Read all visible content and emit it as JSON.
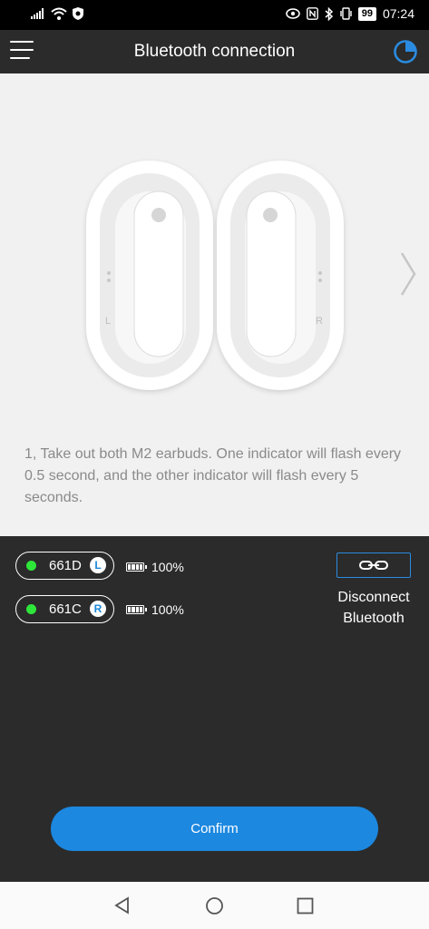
{
  "status": {
    "battery": "99",
    "time": "07:24"
  },
  "appbar": {
    "title": "Bluetooth connection"
  },
  "hero": {
    "left_label": "L",
    "right_label": "R",
    "instruction": "1, Take out both M2 earbuds. One indicator will flash every 0.5 second, and the other indicator will flash every 5 seconds."
  },
  "devices": [
    {
      "name": "661D",
      "side": "L",
      "battery": "100%",
      "connected_color": "#2ee63a"
    },
    {
      "name": "661C",
      "side": "R",
      "battery": "100%",
      "connected_color": "#2ee63a"
    }
  ],
  "disconnect": {
    "label": "Disconnect Bluetooth"
  },
  "confirm_label": "Confirm",
  "colors": {
    "accent": "#1c88e0",
    "background_dark": "#2b2b2b",
    "hero_bg": "#f1f1f1"
  },
  "icons": [
    "menu-icon",
    "refresh-icon",
    "chevron-right-icon",
    "link-icon",
    "back-icon",
    "home-icon",
    "recents-icon"
  ]
}
